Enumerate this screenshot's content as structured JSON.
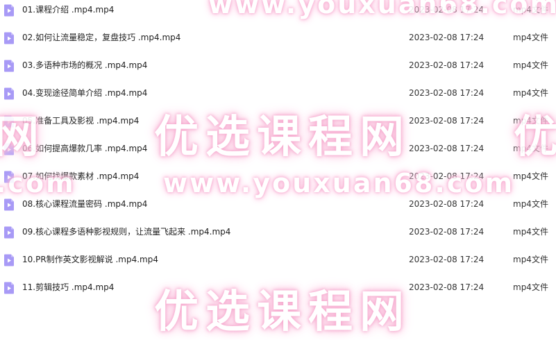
{
  "files": [
    {
      "name": "01.课程介绍 .mp4.mp4",
      "date": "2023-02-08 17:24",
      "type": "mp4文件",
      "icon": "video-file-icon"
    },
    {
      "name": "02.如何让流量稳定，复盘技巧 .mp4.mp4",
      "date": "2023-02-08 17:24",
      "type": "mp4文件",
      "icon": "video-file-icon"
    },
    {
      "name": "03.多语种市场的概况 .mp4.mp4",
      "date": "2023-02-08 17:24",
      "type": "mp4文件",
      "icon": "video-file-icon"
    },
    {
      "name": "04.变现途径简单介绍 .mp4.mp4",
      "date": "2023-02-08 17:24",
      "type": "mp4文件",
      "icon": "video-file-icon"
    },
    {
      "name": "05.准备工具及影视 .mp4.mp4",
      "date": "2023-02-08 17:24",
      "type": "mp4文件",
      "icon": "video-file-icon"
    },
    {
      "name": "06.如何提高爆款几率 .mp4.mp4",
      "date": "2023-02-08 17:24",
      "type": "mp4文件",
      "icon": "video-file-icon"
    },
    {
      "name": "07.如何找爆款素材 .mp4.mp4",
      "date": "2023-02-08 17:24",
      "type": "mp4文件",
      "icon": "video-file-icon"
    },
    {
      "name": "08.核心课程流量密码 .mp4.mp4",
      "date": "2023-02-08 17:24",
      "type": "mp4文件",
      "icon": "video-file-icon"
    },
    {
      "name": "09.核心课程多语种影视规则，让流量飞起来 .mp4.mp4",
      "date": "2023-02-08 17:24",
      "type": "mp4文件",
      "icon": "video-file-icon"
    },
    {
      "name": "10.PR制作英文影视解说 .mp4.mp4",
      "date": "2023-02-08 17:24",
      "type": "mp4文件",
      "icon": "video-file-icon"
    },
    {
      "name": "11.剪辑技巧 .mp4.mp4",
      "date": "2023-02-08 17:24",
      "type": "mp4文件",
      "icon": "video-file-icon"
    }
  ],
  "watermark": {
    "url": "www.youxuan68.com",
    "cn": "优选课程网",
    "edge_left_cn": "网",
    "edge_left_url": ".com",
    "edge_right_cn": "优"
  },
  "colors": {
    "icon_fill": "#a89af6",
    "icon_triangle": "#ffffff",
    "watermark_glow": "#f7a9cf"
  }
}
